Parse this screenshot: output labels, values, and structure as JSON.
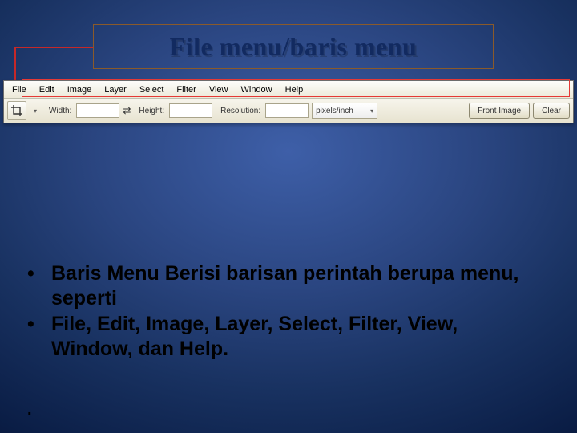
{
  "title": "File menu/baris menu",
  "menubar": {
    "items": [
      "File",
      "Edit",
      "Image",
      "Layer",
      "Select",
      "Filter",
      "View",
      "Window",
      "Help"
    ]
  },
  "optionsbar": {
    "crop_icon": "crop",
    "width_label": "Width:",
    "width_value": "",
    "swap_icon": "⇄",
    "height_label": "Height:",
    "height_value": "",
    "resolution_label": "Resolution:",
    "resolution_value": "",
    "units_selected": "pixels/inch",
    "front_image_label": "Front Image",
    "clear_label": "Clear"
  },
  "bullets": [
    "Baris Menu Berisi barisan perintah berupa menu, seperti",
    " File, Edit, Image, Layer, Select, Filter, View, Window, dan Help."
  ],
  "trailing_dot": "."
}
